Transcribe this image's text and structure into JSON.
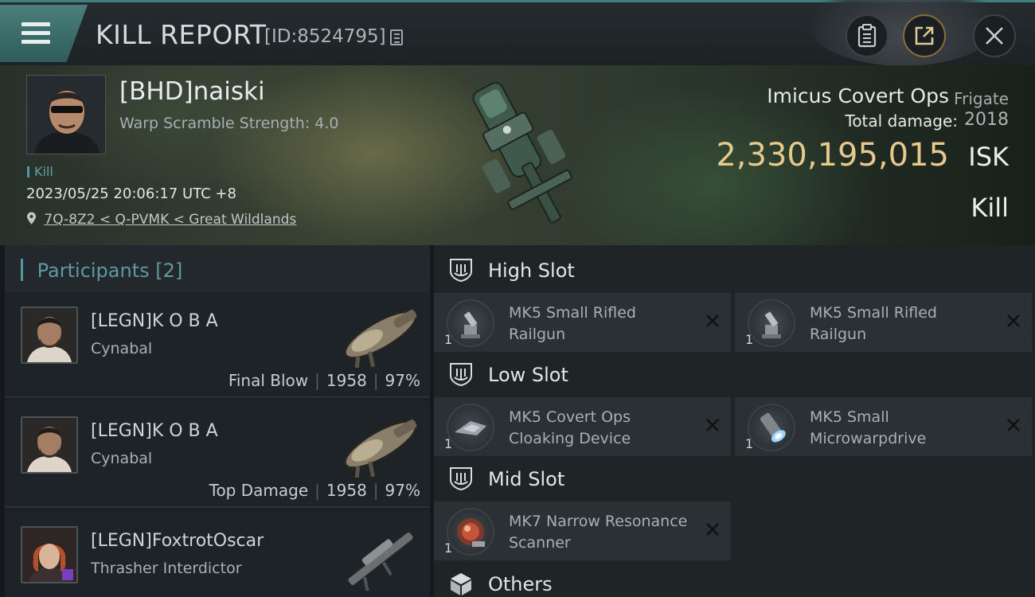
{
  "header": {
    "title": "KILL REPORT",
    "report_id": "[ID:8524795]"
  },
  "victim": {
    "name": "[BHD]naiski",
    "warp_scramble": "Warp Scramble Strength: 4.0",
    "tag": "Kill",
    "datetime": "2023/05/25 20:06:17 UTC +8",
    "location": "7Q-8Z2 < Q-PVMK < Great Wildlands",
    "ship_name": "Imicus Covert Ops",
    "ship_class": "Frigate",
    "total_damage_label": "Total damage:",
    "total_damage": "2018",
    "isk_value": "2,330,195,015",
    "isk_unit": "ISK",
    "result": "Kill"
  },
  "participants": {
    "label": "Participants",
    "count": "[2]",
    "rows": [
      {
        "name": "[LEGN]K O B A",
        "ship": "Cynabal",
        "role": "Final Blow",
        "damage": "1958",
        "percent": "97%"
      },
      {
        "name": "[LEGN]K O B A",
        "ship": "Cynabal",
        "role": "Top Damage",
        "damage": "1958",
        "percent": "97%"
      },
      {
        "name": "[LEGN]FoxtrotOscar",
        "ship": "Thrasher Interdictor",
        "role": "",
        "damage": "",
        "percent": ""
      }
    ]
  },
  "fitting": {
    "high_slot": {
      "label": "High Slot",
      "modules": [
        {
          "name": "MK5 Small Rifled Railgun",
          "qty": "1"
        },
        {
          "name": "MK5 Small Rifled Railgun",
          "qty": "1"
        }
      ]
    },
    "low_slot": {
      "label": "Low Slot",
      "modules": [
        {
          "name": "MK5 Covert Ops Cloaking Device",
          "qty": "1"
        },
        {
          "name": "MK5 Small Microwarpdrive",
          "qty": "1"
        }
      ]
    },
    "mid_slot": {
      "label": "Mid Slot",
      "modules": [
        {
          "name": "MK7 Narrow Resonance Scanner",
          "qty": "1"
        }
      ]
    },
    "others": {
      "label": "Others"
    }
  },
  "colors": {
    "accent": "#4e9aa0",
    "isk": "#e7c98b",
    "menu": "#3f716e"
  },
  "icons": {
    "menu": "hamburger-icon",
    "copy": "copy-icon",
    "clipboard": "clipboard-icon",
    "share": "share-icon",
    "close": "close-icon",
    "location": "location-pin-icon",
    "slot": "slot-shield-icon",
    "others": "cube-icon",
    "remove": "x-icon"
  }
}
